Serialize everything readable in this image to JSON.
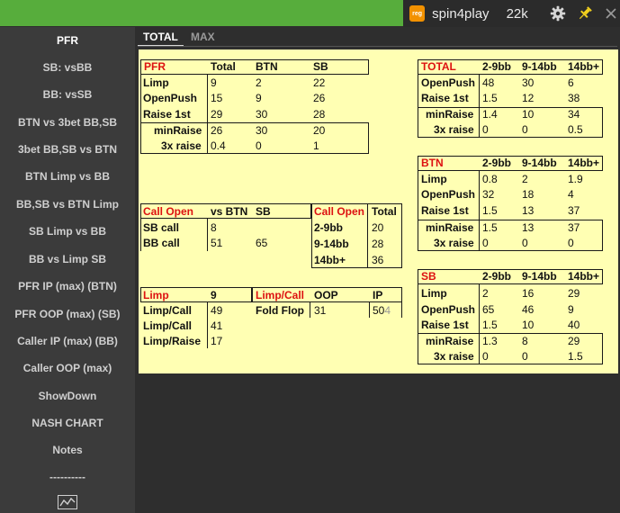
{
  "titlebar": {
    "logo_text": "reg",
    "app_name": "spin4play",
    "count": "22k"
  },
  "sidebar": {
    "items": [
      {
        "label": "PFR",
        "active": true
      },
      {
        "label": "SB: vsBB"
      },
      {
        "label": "BB: vsSB"
      },
      {
        "label": "BTN vs 3bet BB,SB"
      },
      {
        "label": "3bet BB,SB vs BTN"
      },
      {
        "label": "BTN Limp vs BB"
      },
      {
        "label": "BB,SB vs BTN Limp"
      },
      {
        "label": "SB Limp vs BB"
      },
      {
        "label": "BB vs Limp SB"
      },
      {
        "label": "PFR IP (max) (BTN)"
      },
      {
        "label": "PFR OOP (max) (SB)"
      },
      {
        "label": "Caller IP (max) (BB)"
      },
      {
        "label": "Caller OOP (max)"
      },
      {
        "label": "ShowDown"
      },
      {
        "label": "NASH CHART"
      },
      {
        "label": "Notes"
      },
      {
        "label": "----------"
      }
    ]
  },
  "tabs": [
    {
      "label": "TOTAL",
      "active": true
    },
    {
      "label": "MAX"
    }
  ],
  "pfr_table": {
    "header": [
      "PFR",
      "Total",
      "BTN",
      "SB"
    ],
    "rows": [
      [
        "Limp",
        "9",
        "2",
        "22"
      ],
      [
        "OpenPush",
        "15",
        "9",
        "26"
      ],
      [
        "Raise 1st",
        "29",
        "30",
        "28"
      ],
      [
        "minRaise",
        "26",
        "30",
        "20"
      ],
      [
        "3x raise",
        "0.4",
        "0",
        "1"
      ]
    ]
  },
  "callopen_table": {
    "header": [
      "Call Open",
      "vs BTN",
      "SB"
    ],
    "rows": [
      [
        "SB call",
        "8",
        ""
      ],
      [
        "BB call",
        "51",
        "65"
      ]
    ]
  },
  "callopen_total": {
    "header": [
      "Call Open",
      "Total"
    ],
    "rows": [
      [
        "2-9bb",
        "20"
      ],
      [
        "9-14bb",
        "28"
      ],
      [
        "14bb+",
        "36"
      ]
    ]
  },
  "limp_table": {
    "header": [
      "Limp",
      "9"
    ],
    "rows": [
      [
        "Limp/Call",
        "49"
      ],
      [
        "Limp/Call",
        "41"
      ],
      [
        "Limp/Raise",
        "17"
      ]
    ]
  },
  "limpcall_table": {
    "header": [
      "Limp/Call",
      "OOP",
      "IP"
    ],
    "rows": [
      [
        "Fold Flop",
        "31",
        "50",
        "4"
      ]
    ]
  },
  "total_table": {
    "header": [
      "TOTAL",
      "2-9bb",
      "9-14bb",
      "14bb+"
    ],
    "rows": [
      [
        "OpenPush",
        "48",
        "30",
        "6"
      ],
      [
        "Raise 1st",
        "1.5",
        "12",
        "38"
      ],
      [
        "minRaise",
        "1.4",
        "10",
        "34"
      ],
      [
        "3x raise",
        "0",
        "0",
        "0.5"
      ]
    ]
  },
  "btn_table": {
    "header": [
      "BTN",
      "2-9bb",
      "9-14bb",
      "14bb+"
    ],
    "rows": [
      [
        "Limp",
        "0.8",
        "2",
        "1.9"
      ],
      [
        "OpenPush",
        "32",
        "18",
        "4"
      ],
      [
        "Raise 1st",
        "1.5",
        "13",
        "37"
      ],
      [
        "minRaise",
        "1.5",
        "13",
        "37"
      ],
      [
        "3x raise",
        "0",
        "0",
        "0"
      ]
    ]
  },
  "sb_table": {
    "header": [
      "SB",
      "2-9bb",
      "9-14bb",
      "14bb+"
    ],
    "rows": [
      [
        "Limp",
        "2",
        "16",
        "29"
      ],
      [
        "OpenPush",
        "65",
        "46",
        "9"
      ],
      [
        "Raise 1st",
        "1.5",
        "10",
        "40"
      ],
      [
        "minRaise",
        "1.3",
        "8",
        "29"
      ],
      [
        "3x raise",
        "0",
        "0",
        "1.5"
      ]
    ]
  },
  "colors": {
    "titlebar_green": "#57ad3c",
    "panel_yellow": "#ffffb3",
    "header_red": "#dd1111",
    "logo_orange": "#f29100",
    "pin_yellow": "#f2d01e"
  }
}
